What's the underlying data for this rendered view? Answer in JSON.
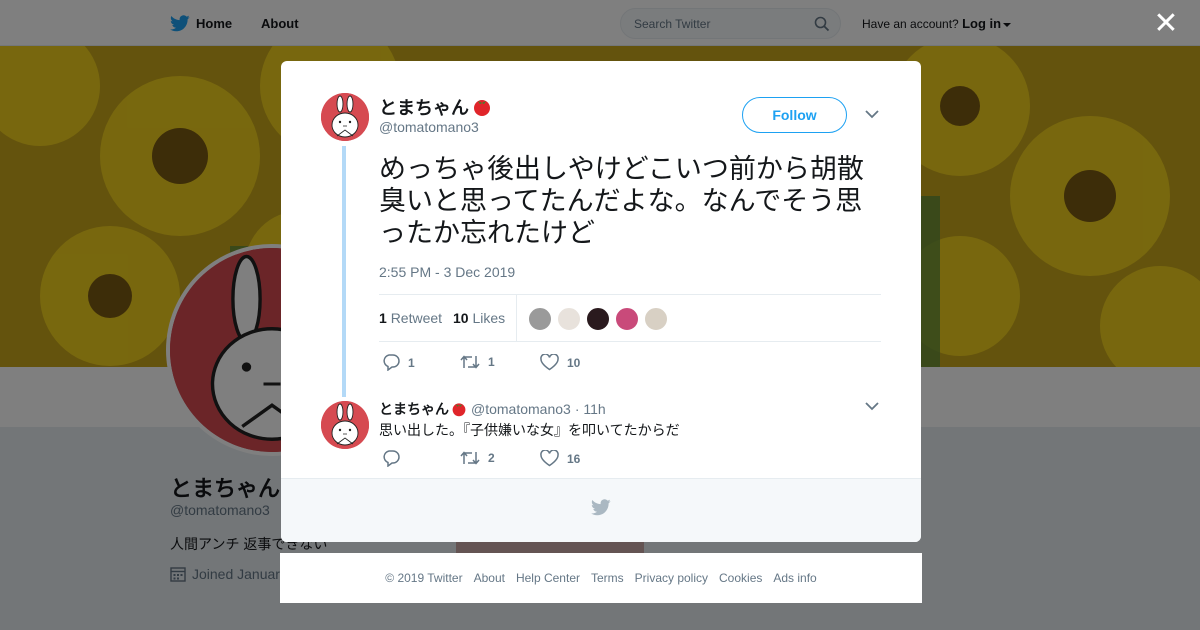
{
  "topbar": {
    "home_label": "Home",
    "about_label": "About",
    "search_placeholder": "Search Twitter",
    "account_prompt": "Have an account?",
    "login_label": "Log in"
  },
  "profile": {
    "name": "とまちゃん",
    "handle": "@tomatomano3",
    "bio": "人間アンチ 返事できない",
    "joined": "Joined Januar"
  },
  "tweet": {
    "author_name": "とまちゃん",
    "author_emoji": "🍅",
    "author_handle": "@tomatomano3",
    "follow_label": "Follow",
    "text": "めっちゃ後出しやけどこいつ前から胡散臭いと思ってたんだよな。なんでそう思ったか忘れたけど",
    "timestamp": "2:55 PM - 3 Dec 2019",
    "retweet_count": "1",
    "retweet_label": "Retweet",
    "like_count": "10",
    "like_label": "Likes",
    "actions": {
      "reply_count": "1",
      "retweet_count": "1",
      "like_count": "10"
    }
  },
  "reply": {
    "author_name": "とまちゃん",
    "author_handle": "@tomatomano3",
    "time": "· 11h",
    "text": "思い出した。『子供嫌いな女』を叩いてたからだ",
    "actions": {
      "reply_count": "",
      "retweet_count": "2",
      "like_count": "16"
    }
  },
  "footer": {
    "links": [
      "© 2019 Twitter",
      "About",
      "Help Center",
      "Terms",
      "Privacy policy",
      "Cookies",
      "Ads info"
    ]
  },
  "colors": {
    "twitter_blue": "#1da1f2",
    "avatar_red": "#d64a51",
    "muted_text": "#657786"
  }
}
